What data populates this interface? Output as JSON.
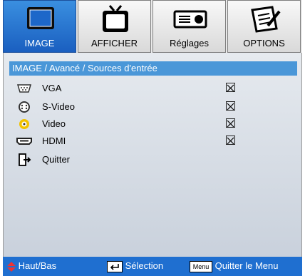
{
  "tabs": [
    {
      "label": "IMAGE",
      "icon": "monitor-icon",
      "active": true
    },
    {
      "label": "AFFICHER",
      "icon": "tv-icon",
      "active": false
    },
    {
      "label": "Réglages",
      "icon": "projector-icon",
      "active": false
    },
    {
      "label": "OPTIONS",
      "icon": "notepad-icon",
      "active": false
    }
  ],
  "breadcrumb": "IMAGE / Avancé / Sources d'entrée",
  "items": [
    {
      "label": "VGA",
      "icon": "vga-connector-icon",
      "checked": true
    },
    {
      "label": "S-Video",
      "icon": "svideo-connector-icon",
      "checked": true
    },
    {
      "label": "Video",
      "icon": "video-connector-icon",
      "checked": true
    },
    {
      "label": "HDMI",
      "icon": "hdmi-connector-icon",
      "checked": true
    },
    {
      "label": "Quitter",
      "icon": "exit-icon"
    }
  ],
  "footer": {
    "nav_label": "Haut/Bas",
    "select_label": "Sélection",
    "menu_key": "Menu",
    "quit_label": "Quitter le Menu"
  },
  "colors": {
    "accent": "#1f6fd0",
    "breadcrumb": "#4a97d8",
    "video_icon": "#f2c200"
  }
}
